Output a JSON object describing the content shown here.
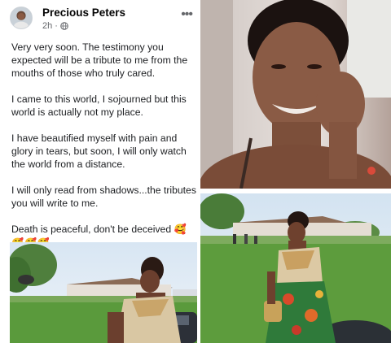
{
  "post": {
    "author": "Precious Peters",
    "time": "2h",
    "paragraphs": [
      "Very very soon. The testimony you expected will be a tribute to me from the mouths of those who truly cared.",
      "I came to this world, I sojourned but this world is actually not my place.",
      "I have beautified myself with pain and glory in tears, but soon, I will only watch the world from a distance.",
      "I will only read from shadows...the tributes you will write to me.",
      "Death is peaceful, don't be deceived 🥰"
    ],
    "emoji_line": "🥰🥰🥰"
  },
  "icons": {
    "avatar": "profile-avatar",
    "globe": "globe-icon",
    "more": "more-options-icon"
  },
  "colors": {
    "name_text": "#050505",
    "meta_text": "#65676b",
    "body_text": "#1c1e21"
  }
}
